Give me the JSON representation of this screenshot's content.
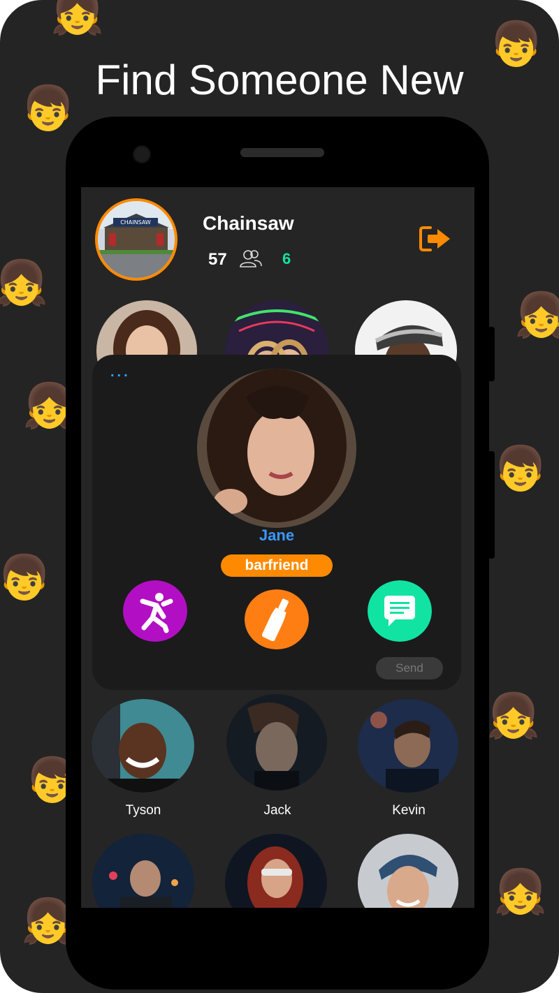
{
  "headline": "Find Someone New",
  "venue": {
    "name": "Chainsaw",
    "sign_text": "CHAINSAW",
    "count_left": "57",
    "count_right": "6"
  },
  "profile_card": {
    "dots": "...",
    "name": "Jane",
    "tag": "barfriend",
    "send_label": "Send"
  },
  "people": [
    {
      "name": "Tyson"
    },
    {
      "name": "Jack"
    },
    {
      "name": "Kevin"
    }
  ],
  "colors": {
    "accent_orange": "#ff8a00",
    "accent_purple": "#b20fc4",
    "accent_green": "#11e3a3",
    "name_blue": "#3a98ff"
  },
  "icons": [
    "people-icon",
    "logout-icon",
    "dance-icon",
    "bottle-icon",
    "chat-icon"
  ]
}
